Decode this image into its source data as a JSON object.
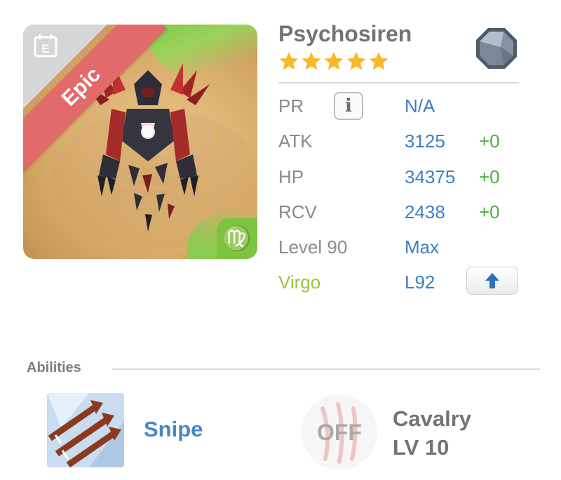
{
  "monster": {
    "name": "Psychosiren",
    "rarity": "Epic",
    "stars": 5,
    "zodiac_glyph": "♍",
    "icons": {
      "element": "gem-icon",
      "calendar": "calendar-icon",
      "zodiac": "virgo-icon"
    }
  },
  "stats": {
    "pr": {
      "label": "PR",
      "info": "i",
      "value": "N/A"
    },
    "atk": {
      "label": "ATK",
      "value": "3125",
      "bonus": "+0"
    },
    "hp": {
      "label": "HP",
      "value": "34375",
      "bonus": "+0"
    },
    "rcv": {
      "label": "RCV",
      "value": "2438",
      "bonus": "+0"
    },
    "level": {
      "label": "Level 90",
      "value": "Max"
    },
    "zodiac": {
      "label": "Virgo",
      "value": "L92"
    }
  },
  "abilities": {
    "title": "Abilities",
    "primary": {
      "name": "Snipe",
      "icon": "snipe-arrows-icon"
    },
    "secondary": {
      "status": "OFF",
      "name": "Cavalry",
      "level": "LV 10",
      "icon": "claw-scratch-icon"
    }
  },
  "colors": {
    "accent_blue": "#3b7fc4",
    "bonus_green": "#4fae3d",
    "epic_red": "#e36a6a",
    "virgo_green": "#9bc53d",
    "star_gold": "#f7b82a"
  }
}
